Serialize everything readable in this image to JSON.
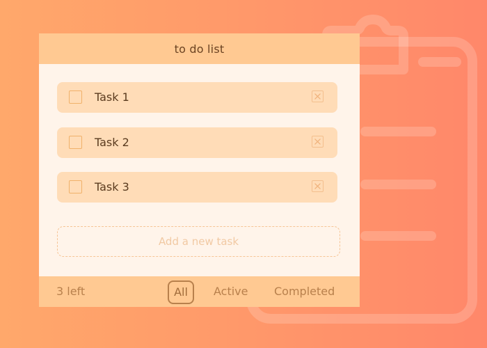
{
  "header": {
    "title": "to do list"
  },
  "tasks": [
    {
      "label": "Task 1",
      "completed": false
    },
    {
      "label": "Task 2",
      "completed": false
    },
    {
      "label": "Task 3",
      "completed": false
    }
  ],
  "add_task": {
    "placeholder": "Add a new task"
  },
  "footer": {
    "items_left": "3 left",
    "filters": [
      {
        "label": "All",
        "selected": true
      },
      {
        "label": "Active",
        "selected": false
      },
      {
        "label": "Completed",
        "selected": false
      }
    ]
  },
  "colors": {
    "background_start": "#ffa86b",
    "background_end": "#ff876a",
    "header_bg": "#ffc992",
    "card_bg": "#fff4ea",
    "task_bg": "#ffdcb7",
    "footer_text": "#b8804c"
  },
  "icons": {
    "checkbox": "checkbox-icon",
    "delete": "close-icon",
    "background": "clipboard-icon"
  }
}
